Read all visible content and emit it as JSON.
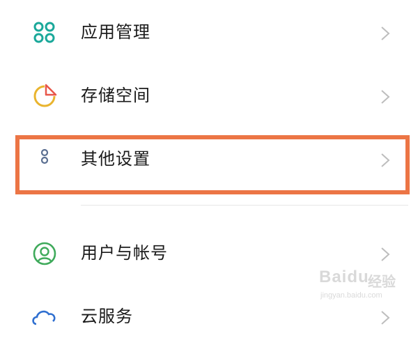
{
  "settings": {
    "items": [
      {
        "label": "应用管理",
        "icon": "app-management-icon",
        "icon_color": "#1aa89a"
      },
      {
        "label": "存储空间",
        "icon": "storage-icon",
        "icon_color": "#e9b42e",
        "icon_accent": "#e8574a"
      },
      {
        "label": "其他设置",
        "icon": "other-settings-icon",
        "icon_color": "#5b6f91"
      },
      {
        "label": "用户与帐号",
        "icon": "user-account-icon",
        "icon_color": "#3faa5b"
      },
      {
        "label": "云服务",
        "icon": "cloud-service-icon",
        "icon_color": "#2f6fd0"
      }
    ]
  },
  "highlight_color": "#ec7545",
  "watermark": {
    "brand": "Baidu",
    "cn": "经验",
    "url": "jingyan.baidu.com"
  }
}
